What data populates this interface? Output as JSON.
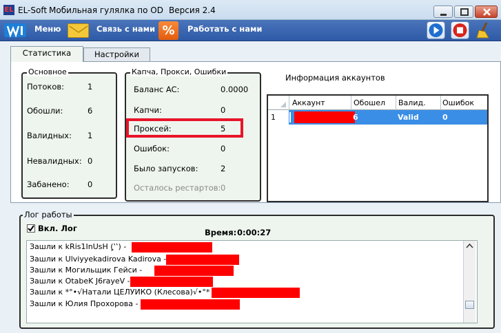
{
  "window": {
    "app_icon_text": "EL",
    "app_name": "EL-Soft",
    "title": "Мобильная гулялка по OD",
    "version": "Версия 2.4"
  },
  "menubar": {
    "menu": "Меню",
    "contact": "Связь с нами",
    "work": "Работать с нами"
  },
  "tabs": [
    {
      "label": "Статистика",
      "active": true
    },
    {
      "label": "Настройки",
      "active": false
    }
  ],
  "main_stats": {
    "title": "Основное",
    "rows": [
      {
        "label": "Потоков:",
        "value": "1"
      },
      {
        "label": "Обошли:",
        "value": "6"
      },
      {
        "label": "Валидных:",
        "value": "1"
      },
      {
        "label": "Невалидных:",
        "value": "0"
      },
      {
        "label": "Забанено:",
        "value": "0"
      }
    ]
  },
  "captcha_stats": {
    "title": "Капча, Прокси, Ошибки",
    "rows": [
      {
        "label": "Баланс AC:",
        "value": "0.0000"
      },
      {
        "label": "Капчи:",
        "value": "0"
      },
      {
        "label": "Проксей:",
        "value": "5"
      },
      {
        "label": "Ошибок:",
        "value": "0"
      },
      {
        "label": "Было запусков:",
        "value": "2"
      },
      {
        "label": "Осталось рестартов:",
        "value": "0"
      }
    ]
  },
  "accounts": {
    "title": "Информация аккаунтов",
    "columns": [
      "Аккаунт",
      "Обошел",
      "Валид.",
      "Ошибок"
    ],
    "rows": [
      {
        "num": "1",
        "account": "",
        "visited": "6",
        "valid": "Valid",
        "errors": "0"
      }
    ]
  },
  "log": {
    "title": "Лог работы",
    "checkbox_label": "Вкл. Лог",
    "checkbox_checked": true,
    "time_label": "Время:",
    "time_value": "0:00:27",
    "lines": [
      "Зашли к kRis1InUsH (ٍ‛‛) -",
      "Зашли к Ulviyyekadirova Kadirova -",
      "Зашли к Могильщик Гейси -",
      "Зашли к OtabeK J6rayeV -",
      "Зашли к *°•√Натали ЦЕЛУИКО (Клесова)√•°* -",
      "Зашли к Юлия Прохорова -"
    ]
  },
  "colors": {
    "menubar": "#2e5aa6",
    "selection": "#3a8ee6",
    "highlight": "#e8142a",
    "redaction": "#ff0000"
  }
}
